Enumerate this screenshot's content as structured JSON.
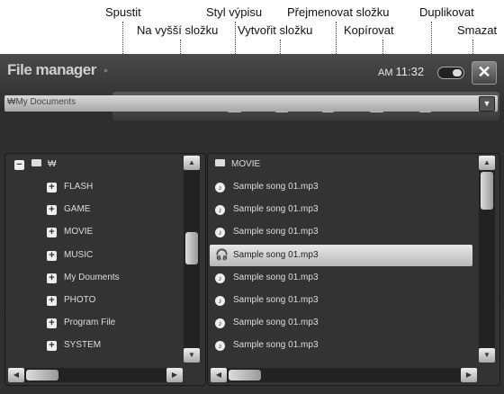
{
  "callouts": {
    "spustit": "Spustit",
    "na_vyssi": "Na vyšší složku",
    "styl": "Styl výpisu",
    "vytvorit": "Vytvořit složku",
    "prejmenovat": "Přejmenovat složku",
    "kopirovat": "Kopírovat",
    "duplikovat": "Duplikovat",
    "smazat": "Smazat"
  },
  "app": {
    "title": "File manager",
    "ampm": "AM",
    "time": "11:32",
    "close_glyph": "✕"
  },
  "path": {
    "value": "₩My Documents",
    "drop_glyph": "▼"
  },
  "tree": {
    "root_label": "₩",
    "items": [
      "FLASH",
      "GAME",
      "MOVIE",
      "MUSIC",
      "My Douments",
      "PHOTO",
      "Program File",
      "SYSTEM"
    ]
  },
  "files": {
    "folder": "MOVIE",
    "items": [
      "Sample song 01.mp3",
      "Sample song 01.mp3",
      "Sample song 01.mp3",
      "Sample song 01.mp3",
      "Sample song 01.mp3",
      "Sample song 01.mp3",
      "Sample song 01.mp3",
      "Sample song 01.mp3"
    ],
    "selected_index": 3
  },
  "icons": {
    "toolbar": [
      "play-icon",
      "folder-up-icon",
      "list-style-icon",
      "new-folder-icon",
      "rename-folder-icon",
      "copy-icon",
      "duplicate-icon",
      "delete-icon"
    ]
  }
}
